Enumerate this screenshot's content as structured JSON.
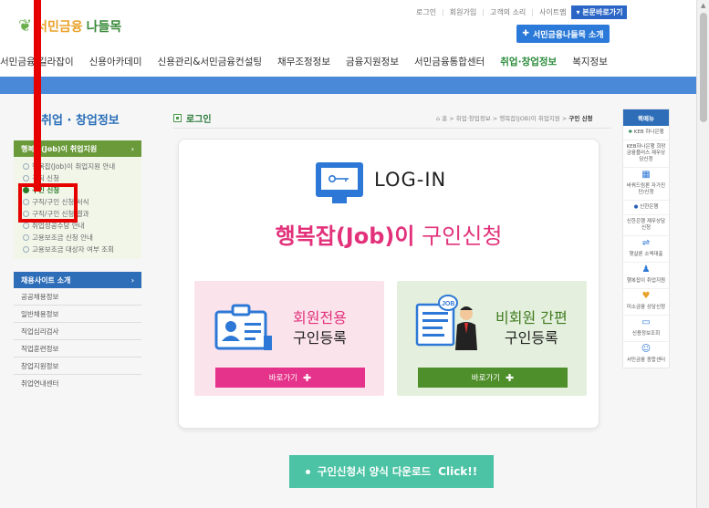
{
  "util": {
    "items": [
      "로그인",
      "회원가입",
      "고객의 소리",
      "사이트맵"
    ],
    "skip": "본문바로가기"
  },
  "logo": {
    "part1": "서민금융",
    "part2": "나들목"
  },
  "intro_button": "서민금융나들목 소개",
  "gnb": [
    "서민금융 길라잡이",
    "신용아카데미",
    "신용관리&서민금융컨설팅",
    "채무조정정보",
    "금융지원정보",
    "서민금융통합센터",
    "취업·창업정보",
    "복지정보"
  ],
  "gnb_active_index": 6,
  "sidebar": {
    "title": "취업 · 창업정보",
    "section1": "행복잡(Job)이 취업지원",
    "items": [
      "행복잡(Job)이 취업지원 안내",
      "구직 신청",
      "구인 신청",
      "구직/구인 신청 서식",
      "구직/구인 신청 결과",
      "취업성공수당 안내",
      "고용보조금 신청 안내",
      "고용보조금 대상자 여부 조회"
    ],
    "current_index": 2,
    "section2": "채용사이트 소개",
    "links": [
      "공공채용정보",
      "일반채용정보",
      "직업심리검사",
      "직업훈련정보",
      "창업지원정보",
      "취업연내센터"
    ]
  },
  "page_title": "로그인",
  "breadcrumb": {
    "path": "홈 > 취업·창업정보 > 행복잡(JOB)이 취업지원 > ",
    "current": "구인 신청"
  },
  "login_text": "LOG-IN",
  "headline": {
    "part1": "행복잡(Job)이",
    "part2": " 구인신청"
  },
  "card_member": {
    "line1": "회원전용",
    "line2": "구인등록",
    "go": "바로가기"
  },
  "card_guest": {
    "line1": "비회원 간편",
    "line2": "구인등록",
    "go": "바로가기"
  },
  "download": {
    "text": "구인신청서 양식 다운로드",
    "click": "Click!!"
  },
  "quick": {
    "title": "퀵메뉴",
    "items": [
      "KEB 하나은행",
      "KEB하나은행 희망금융플러스 재무상담신청",
      "바꿔드림론 자가진단/신청",
      "신한은행",
      "신한은행 재무상담신청",
      "햇살론 소액대출",
      "행복잡이 취업지원",
      "미소금융 상담신청",
      "신용정보조회",
      "서민금융 종합센터"
    ]
  },
  "colors": {
    "accent_green": "#2a8b3a",
    "accent_blue": "#4a88d8",
    "pink": "#e2317a",
    "annotation": "#e60000"
  }
}
